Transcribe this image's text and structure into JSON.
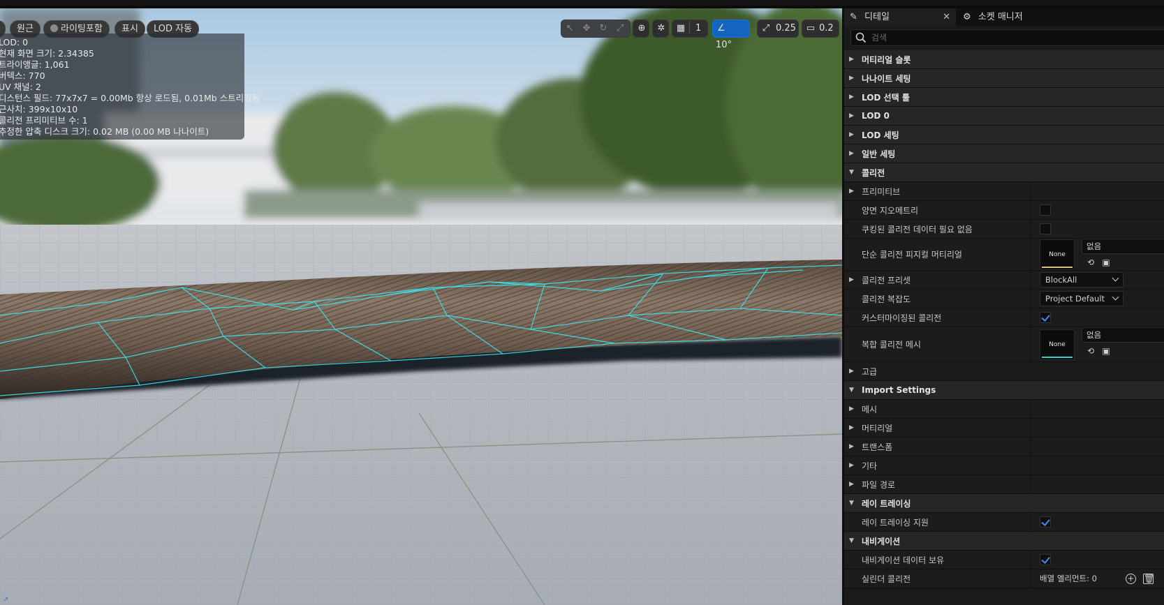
{
  "viewport": {
    "toolbar_left": {
      "perspective": "원근",
      "lighting": "라이팅포함",
      "show": "표시",
      "lod": "LOD 자동"
    },
    "stats_lines": [
      "LOD:  0",
      "현재 화면 크기: 2.34385",
      "트라이앵글: 1,061",
      "버텍스: 770",
      "UV 채널:  2",
      "디스턴스 필드:  77x7x7 = 0.00Mb 항상 로드됨, 0.01Mb 스트리밍됨",
      "근사치: 399x10x10",
      "콜리전 프리미티브 수: 1",
      "추정한 압축 디스크 크기: 0.02 MB (0.00 MB 나나이트)"
    ],
    "toolbar_right": {
      "grid_value": "1",
      "angle_value": "10°",
      "scale_value": "0.25",
      "camera_value": "0.2"
    }
  },
  "panel": {
    "tabs": [
      {
        "label": "디테일"
      },
      {
        "label": "소켓 매니저"
      }
    ],
    "search_placeholder": "검색",
    "rows": {
      "material_slots": "머티리얼 슬롯",
      "nanite_settings": "나나이트 세팅",
      "lod_picker": "LOD 선택 툴",
      "lod0": "LOD 0",
      "lod_settings": "LOD 세팅",
      "general_settings": "일반 세팅",
      "collision": "콜리전",
      "primitives": "프리미티브",
      "double_sided": "양면 지오메트리",
      "no_cooked_collision": "쿠킹된 콜리전 데이터 필요 없음",
      "simple_phys_material": "단순 콜리전 피지컬 머티리얼",
      "collision_presets": "콜리전 프리셋",
      "collision_complexity": "콜리전 복잡도",
      "customized_collision": "커스터마이징된 콜리전",
      "complex_collision_mesh": "복합 콜리전 메시",
      "advanced": "고급",
      "import_settings": "Import Settings",
      "mesh": "메시",
      "material": "머티리얼",
      "transform": "트랜스폼",
      "misc": "기타",
      "file_path": "파일 경로",
      "ray_tracing": "레이 트레이싱",
      "support_ray_tracing": "레이 트레이싱 지원",
      "navigation": "내비게이션",
      "has_navigation_data": "내비게이션 데이터 보유",
      "cylinder_collision": "실린더 콜리전"
    },
    "values": {
      "thumb_none": "None",
      "asset_none": "없음",
      "collision_preset": "BlockAll",
      "collision_complexity": "Project Default",
      "array_elements": "배열 엘리먼트: 0",
      "double_sided_checked": false,
      "no_cooked_checked": false,
      "customized_collision_checked": true,
      "support_ray_tracing_checked": true,
      "has_navigation_data_checked": true
    }
  },
  "colors": {
    "accent_blue": "#1565c0",
    "wire_cyan": "#39e6ee",
    "thumb_material_bar": "#d9c27a",
    "thumb_mesh_bar": "#2fd3d6"
  }
}
